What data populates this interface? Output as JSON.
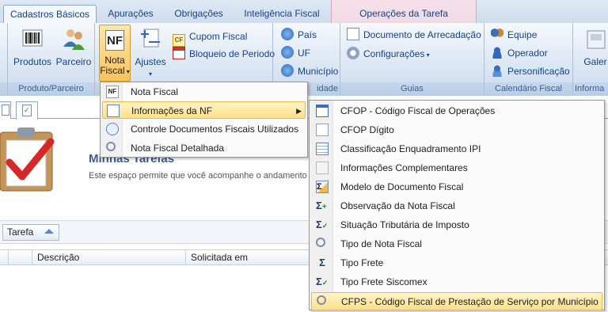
{
  "ribbon_tabs": [
    {
      "label": "Cadastros Básicos",
      "active": true
    },
    {
      "label": "Apurações",
      "active": false
    },
    {
      "label": "Obrigações",
      "active": false
    },
    {
      "label": "Inteligência Fiscal",
      "active": false
    }
  ],
  "contextual_tab": {
    "label": "Operações da Tarefa"
  },
  "ribbon": {
    "produtos": "Produtos",
    "parceiro": "Parceiro",
    "nota_fiscal_line1": "Nota",
    "nota_fiscal_line2": "Fiscal",
    "nota_fiscal_icon_text": "NF",
    "ajustes": "Ajustes",
    "cupom_fiscal": "Cupom Fiscal",
    "cupom_icon_text": "CF",
    "bloqueio_periodo": "Bloqueio de Periodo",
    "pais": "País",
    "uf": "UF",
    "municipio": "Município",
    "documento_arrecadacao": "Documento de Arrecadação",
    "configuracoes": "Configurações",
    "equipe": "Equipe",
    "operador": "Operador",
    "personificacao": "Personificação",
    "galer": "Galer",
    "group_produto_parceiro": "Produto/Parceiro",
    "group_unidade": "idade",
    "group_guias": "Guias",
    "group_calendario": "Calendário Fiscal",
    "group_informa": "Informa"
  },
  "workspace": {
    "title": "Minhas Tarefas",
    "subtitle": "Este espaço permite que você acompanhe o andamento d",
    "group_chip": "Tarefa",
    "columns": [
      "Descrição",
      "Solicitada em"
    ]
  },
  "menu": {
    "items": [
      {
        "label": "Nota Fiscal",
        "icon": "nf-icon",
        "icon_text": "NF"
      },
      {
        "label": "Informações da NF",
        "icon": "nf-info-icon",
        "highlight": true
      },
      {
        "label": "Controle Documentos Fiscais Utilizados",
        "icon": "control-docs-icon"
      },
      {
        "label": "Nota Fiscal Detalhada",
        "icon": "magnifier-icon"
      }
    ]
  },
  "submenu": {
    "items": [
      {
        "label": "CFOP - Código Fiscal de Operações",
        "icon": "window-icon"
      },
      {
        "label": "CFOP Dígito",
        "icon": "document-icon"
      },
      {
        "label": "Classificação Enquadramento IPI",
        "icon": "table-icon"
      },
      {
        "label": "Informações Complementares",
        "icon": "notes-icon"
      },
      {
        "label": "Modelo de Documento Fiscal",
        "icon": "sigma-doc-icon"
      },
      {
        "label": "Observação da Nota Fiscal",
        "icon": "sigma-plus-icon"
      },
      {
        "label": "Situação Tributária de Imposto",
        "icon": "sigma-check-icon"
      },
      {
        "label": "Tipo de Nota Fiscal",
        "icon": "search-doc-icon"
      },
      {
        "label": "Tipo Frete",
        "icon": "sigma-icon"
      },
      {
        "label": "Tipo Frete Siscomex",
        "icon": "sigma-check-icon"
      },
      {
        "label": "CFPS - Código Fiscal de Prestação de Serviço por Município",
        "icon": "search-doc-icon",
        "highlight": true
      }
    ]
  },
  "colors": {
    "accent": "#15428b",
    "highlight": "#ffe08a",
    "contextual": "#f7e0ea"
  }
}
